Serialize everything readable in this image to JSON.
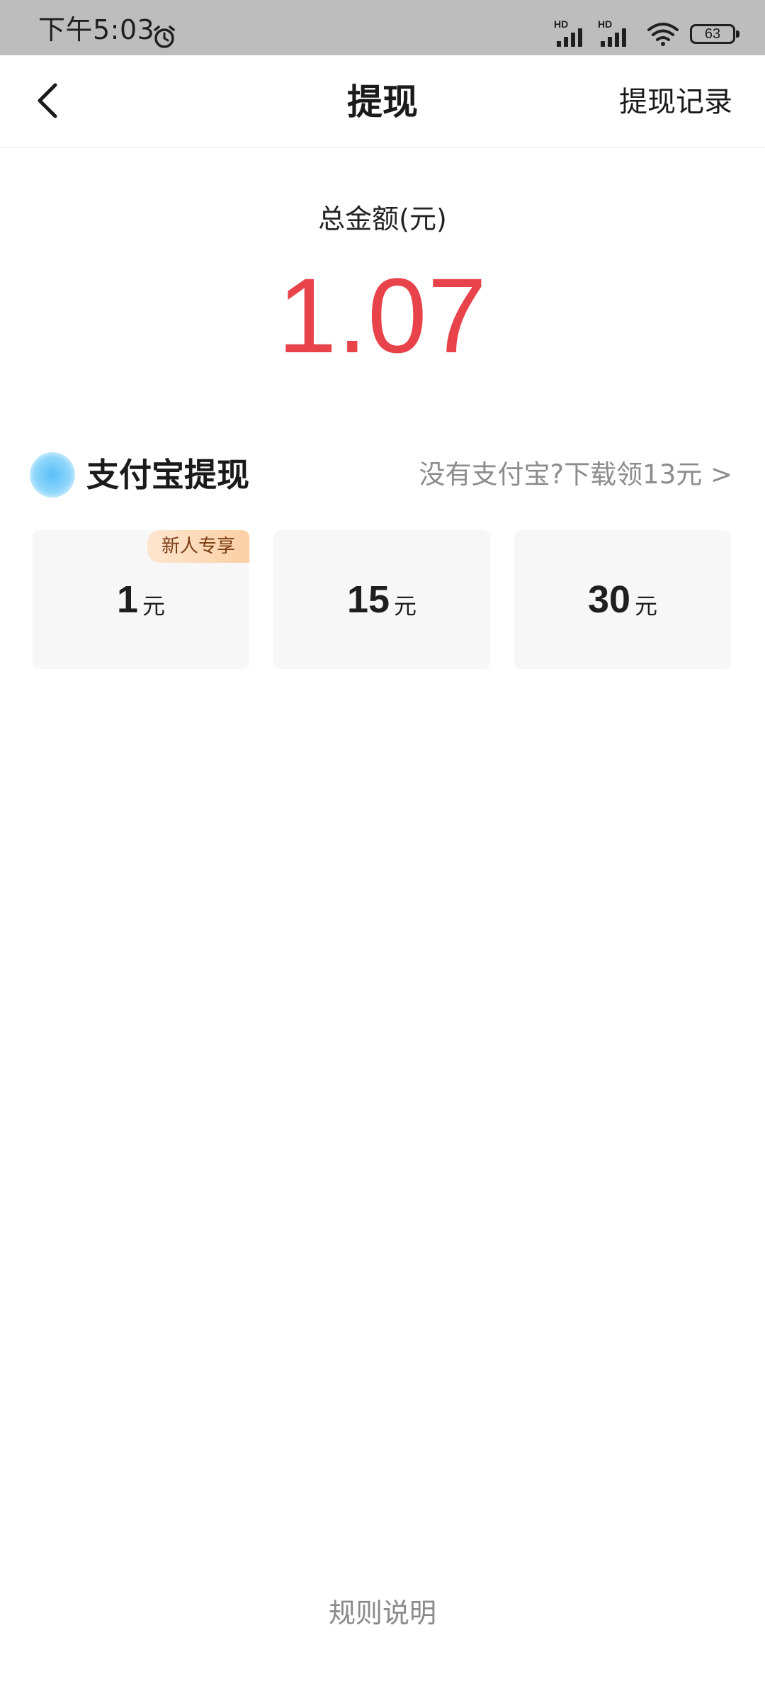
{
  "status_bar": {
    "time": "下午5:03",
    "signal1_label": "HD",
    "signal2_label": "HD",
    "battery": "63"
  },
  "nav": {
    "title": "提现",
    "right_action": "提现记录"
  },
  "balance": {
    "label": "总金额(元)",
    "amount": "1.07",
    "amount_color": "#e8434a"
  },
  "alipay": {
    "title": "支付宝提现",
    "download_link": "没有支付宝?下载领13元 >",
    "logo_color": "#59c0f7"
  },
  "options": [
    {
      "value": "1",
      "unit": "元",
      "badge": "新人专享"
    },
    {
      "value": "15",
      "unit": "元"
    },
    {
      "value": "30",
      "unit": "元"
    }
  ],
  "footer": {
    "rules": "规则说明"
  },
  "icons": [
    "alarm-icon",
    "signal-icon",
    "wifi-icon",
    "battery-icon",
    "back-arrow-icon"
  ]
}
